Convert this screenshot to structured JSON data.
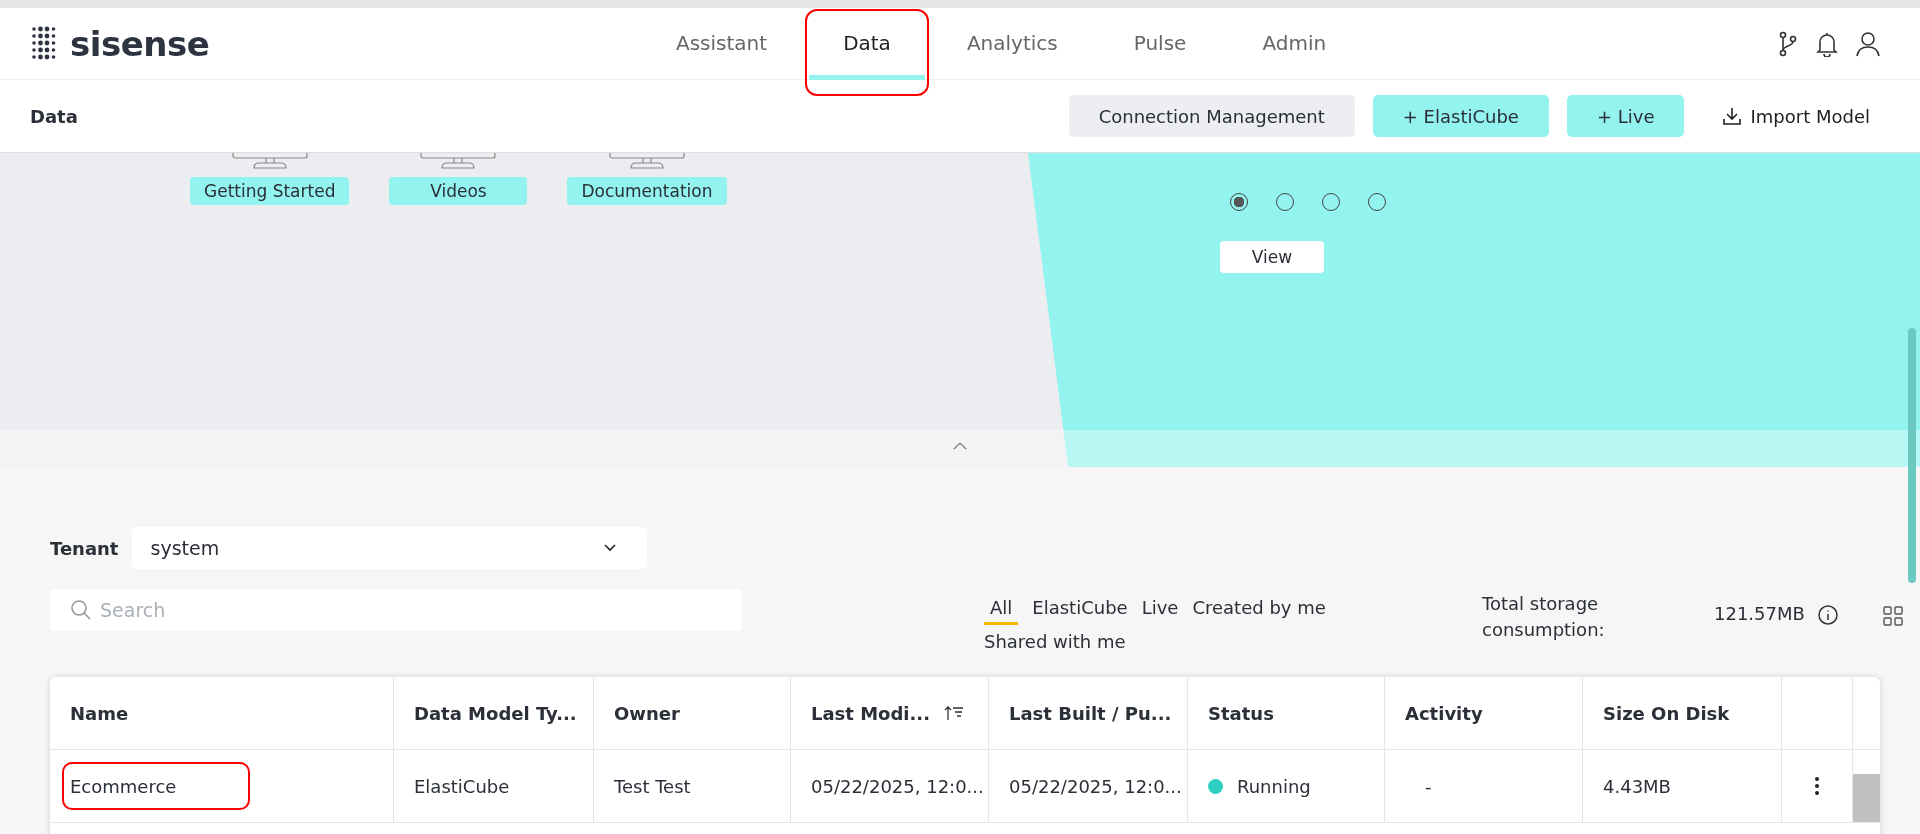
{
  "brand": {
    "name": "sisense"
  },
  "nav_tabs": [
    {
      "label": "Assistant",
      "selected": false,
      "highlighted": false
    },
    {
      "label": "Data",
      "selected": true,
      "highlighted": true
    },
    {
      "label": "Analytics",
      "selected": false,
      "highlighted": false
    },
    {
      "label": "Pulse",
      "selected": false,
      "highlighted": false
    },
    {
      "label": "Admin",
      "selected": false,
      "highlighted": false
    }
  ],
  "page_title": "Data",
  "actions": [
    {
      "label": "Connection Management",
      "kind": "secondary"
    },
    {
      "label": "+ ElastiCube",
      "kind": "primary"
    },
    {
      "label": "+ Live",
      "kind": "primary"
    },
    {
      "label": "Import Model",
      "kind": "download"
    }
  ],
  "banner": {
    "resources": [
      "Getting Started",
      "Videos",
      "Documentation"
    ],
    "carousel_dots": [
      {
        "selected": true
      },
      {
        "selected": false
      },
      {
        "selected": false
      },
      {
        "selected": false
      }
    ],
    "view_button": "View"
  },
  "tenant": {
    "label": "Tenant",
    "value": "system"
  },
  "search": {
    "placeholder": "Search"
  },
  "filters": [
    {
      "label": "All",
      "selected": true
    },
    {
      "label": "ElastiCube",
      "selected": false
    },
    {
      "label": "Live",
      "selected": false
    },
    {
      "label": "Created by me",
      "selected": false
    },
    {
      "label": "Shared with me",
      "selected": false
    }
  ],
  "storage": {
    "label": "Total storage consumption:",
    "value": "121.57MB"
  },
  "table": {
    "columns": [
      {
        "label": "Name",
        "sorted": false
      },
      {
        "label": "Data Model Ty...",
        "sorted": false
      },
      {
        "label": "Owner",
        "sorted": false
      },
      {
        "label": "Last Modi...",
        "sorted": true
      },
      {
        "label": "Last Built / Pu...",
        "sorted": false
      },
      {
        "label": "Status",
        "sorted": false
      },
      {
        "label": "Activity",
        "sorted": false
      },
      {
        "label": "Size On Disk",
        "sorted": false
      }
    ],
    "rows": [
      {
        "name": "Ecommerce",
        "name_highlighted": true,
        "type": "ElastiCube",
        "owner": "Test Test",
        "modified": "05/22/2025, 12:0...",
        "built": "05/22/2025, 12:0...",
        "status": "Running",
        "activity": "-",
        "size": "4.43MB"
      }
    ]
  }
}
